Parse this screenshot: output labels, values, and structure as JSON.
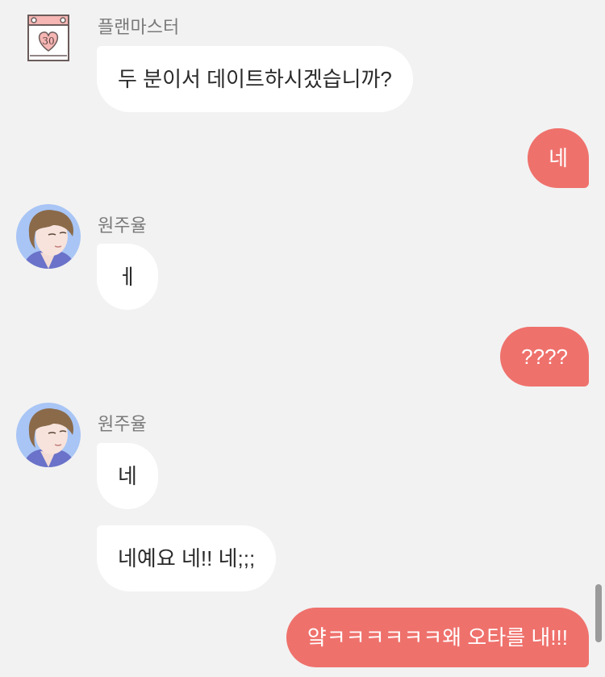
{
  "messages": [
    {
      "sender": "플랜마스터",
      "text": "두 분이서 데이트하시겠습니까?"
    },
    {
      "text": "네"
    },
    {
      "sender": "원주율",
      "text": "ㅔ"
    },
    {
      "text": "????"
    },
    {
      "sender": "원주율",
      "text": "네"
    },
    {
      "text": "네예요 네!! 네;;;"
    },
    {
      "text": "얔ㅋㅋㅋㅋㅋㅋ왜 오타를 내!!!"
    }
  ],
  "calendar": {
    "day": "30"
  },
  "colors": {
    "outgoing": "#ef716c",
    "incoming": "#ffffff",
    "background": "#f2f2f2"
  }
}
